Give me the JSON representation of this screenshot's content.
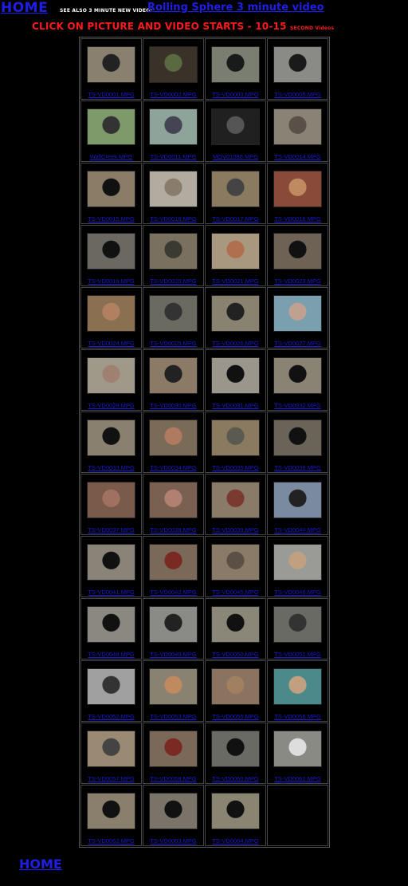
{
  "header": {
    "home_label": "HOME",
    "see_also": "SEE ALSO 3 MINUTE NEW VIDEO:",
    "rolling_link": "Rolling Sphere 3 minute video",
    "click_text": "CLICK ON PICTURE AND VIDEO STARTS - 10-15 ",
    "click_small": "SECOND Videos"
  },
  "footer": {
    "home_label": "HOME"
  },
  "gallery": {
    "rows": [
      [
        {
          "label": "TS-VD0001.MPG",
          "bg": "#8a8070",
          "fg": "#222"
        },
        {
          "label": "TS-VD0002.MPG",
          "bg": "#3a3228",
          "fg": "#5a6a40"
        },
        {
          "label": "TS-VD0003.MPG",
          "bg": "#7a7e70",
          "fg": "#1a1a1a"
        },
        {
          "label": "TS-VD0005.MPG",
          "bg": "#8a8a86",
          "fg": "#1a1a1a"
        }
      ],
      [
        {
          "label": "WallCreek.MPG",
          "bg": "#7f9a6a",
          "fg": "#333"
        },
        {
          "label": "TS-VD0011.MPG",
          "bg": "#8ea39a",
          "fg": "#445"
        },
        {
          "label": "MOV01086.MPG",
          "bg": "#202020",
          "fg": "#555"
        },
        {
          "label": "TS-VD0014.MPG",
          "bg": "#8a8274",
          "fg": "#5a5048"
        }
      ],
      [
        {
          "label": "TS-VD0015.MPG",
          "bg": "#8a7c66",
          "fg": "#111"
        },
        {
          "label": "TS-VD0016.MPG",
          "bg": "#b2aca0",
          "fg": "#8a7c6a"
        },
        {
          "label": "TS-VD0017.MPG",
          "bg": "#8a7a60",
          "fg": "#444"
        },
        {
          "label": "TS-VD0016.MPG",
          "bg": "#8a4a3a",
          "fg": "#c08a60"
        }
      ],
      [
        {
          "label": "TS-VD0019.MPG",
          "bg": "#6a6860",
          "fg": "#111"
        },
        {
          "label": "TS-VD0020.MPG",
          "bg": "#7a7060",
          "fg": "#3a3a30"
        },
        {
          "label": "TS-VD0021.MPG",
          "bg": "#a89880",
          "fg": "#b07050"
        },
        {
          "label": "TS-VD0023.MPG",
          "bg": "#6e6254",
          "fg": "#111"
        }
      ],
      [
        {
          "label": "TS-VD0024.MPG",
          "bg": "#8a7050",
          "fg": "#b08060"
        },
        {
          "label": "TS-VD0025.MPG",
          "bg": "#6a6a60",
          "fg": "#333"
        },
        {
          "label": "TS-VD0026.MPG",
          "bg": "#8a8270",
          "fg": "#222"
        },
        {
          "label": "TS-VD0027.MPG",
          "bg": "#7aa0b0",
          "fg": "#c0a090"
        }
      ],
      [
        {
          "label": "TS-VD0028.MPG",
          "bg": "#a09888",
          "fg": "#a08070"
        },
        {
          "label": "TS-VD0030.MPG",
          "bg": "#8a7a66",
          "fg": "#222"
        },
        {
          "label": "TS-VD0031.MPG",
          "bg": "#9a968c",
          "fg": "#111"
        },
        {
          "label": "TS-VD0032.MPG",
          "bg": "#8a8272",
          "fg": "#111"
        }
      ],
      [
        {
          "label": "TS-VD0033.MPG",
          "bg": "#8a8070",
          "fg": "#111"
        },
        {
          "label": "TS-VD0034.MPG",
          "bg": "#7a6a58",
          "fg": "#b07a60"
        },
        {
          "label": "TS-VD0035.MPG",
          "bg": "#8a7a60",
          "fg": "#5a5a50"
        },
        {
          "label": "TS-VD0036.MPG",
          "bg": "#6a6458",
          "fg": "#111"
        }
      ],
      [
        {
          "label": "TS-VD0037.MPG",
          "bg": "#7a5a4a",
          "fg": "#a07060"
        },
        {
          "label": "TS-VD0038.MPG",
          "bg": "#7a6050",
          "fg": "#b08070"
        },
        {
          "label": "TS-VD0039.MPG",
          "bg": "#8a7a68",
          "fg": "#7a3a30"
        },
        {
          "label": "TS-VD0040.MPG",
          "bg": "#7a8aa0",
          "fg": "#222"
        }
      ],
      [
        {
          "label": "TS-VD0041.MPG",
          "bg": "#8a8478",
          "fg": "#111"
        },
        {
          "label": "TS-VD0042.MPG",
          "bg": "#7a6858",
          "fg": "#7a2a22"
        },
        {
          "label": "TS-VD0045.MPG",
          "bg": "#8a7a68",
          "fg": "#5a5046"
        },
        {
          "label": "TS-VD0046.MPG",
          "bg": "#9a9a96",
          "fg": "#c0a080"
        }
      ],
      [
        {
          "label": "TS-VD0048.MPG",
          "bg": "#8a8880",
          "fg": "#111"
        },
        {
          "label": "TS-VD0049.MPG",
          "bg": "#8a8a86",
          "fg": "#222"
        },
        {
          "label": "TS-VD0050.MPG",
          "bg": "#8a8678",
          "fg": "#111"
        },
        {
          "label": "TS-VD0051.MPG",
          "bg": "#6a6a64",
          "fg": "#333"
        }
      ],
      [
        {
          "label": "TS-VD0052.MPG",
          "bg": "#a0a0a0",
          "fg": "#333"
        },
        {
          "label": "TS-VD0053.MPG",
          "bg": "#8a8270",
          "fg": "#c08a60"
        },
        {
          "label": "TS-VD0055.MPG",
          "bg": "#8a7460",
          "fg": "#a08060"
        },
        {
          "label": "TS-VD0056.MPG",
          "bg": "#4a8a8a",
          "fg": "#c0a080"
        }
      ],
      [
        {
          "label": "TS-VD0057.MPG",
          "bg": "#9a8a74",
          "fg": "#444"
        },
        {
          "label": "TS-VD0058.MPG",
          "bg": "#7a6858",
          "fg": "#7a2a22"
        },
        {
          "label": "TS-VD0060.MPG",
          "bg": "#6a6a64",
          "fg": "#111"
        },
        {
          "label": "TS-VD0061.MPG",
          "bg": "#8a8a84",
          "fg": "#ddd"
        }
      ],
      [
        {
          "label": "TS-VD0062.MPG",
          "bg": "#8a7e6c",
          "fg": "#111"
        },
        {
          "label": "TS-VD0063.MPG",
          "bg": "#7a7468",
          "fg": "#111"
        },
        {
          "label": "TS-VD0064.MPG",
          "bg": "#8a8472",
          "fg": "#111"
        },
        null
      ]
    ]
  }
}
